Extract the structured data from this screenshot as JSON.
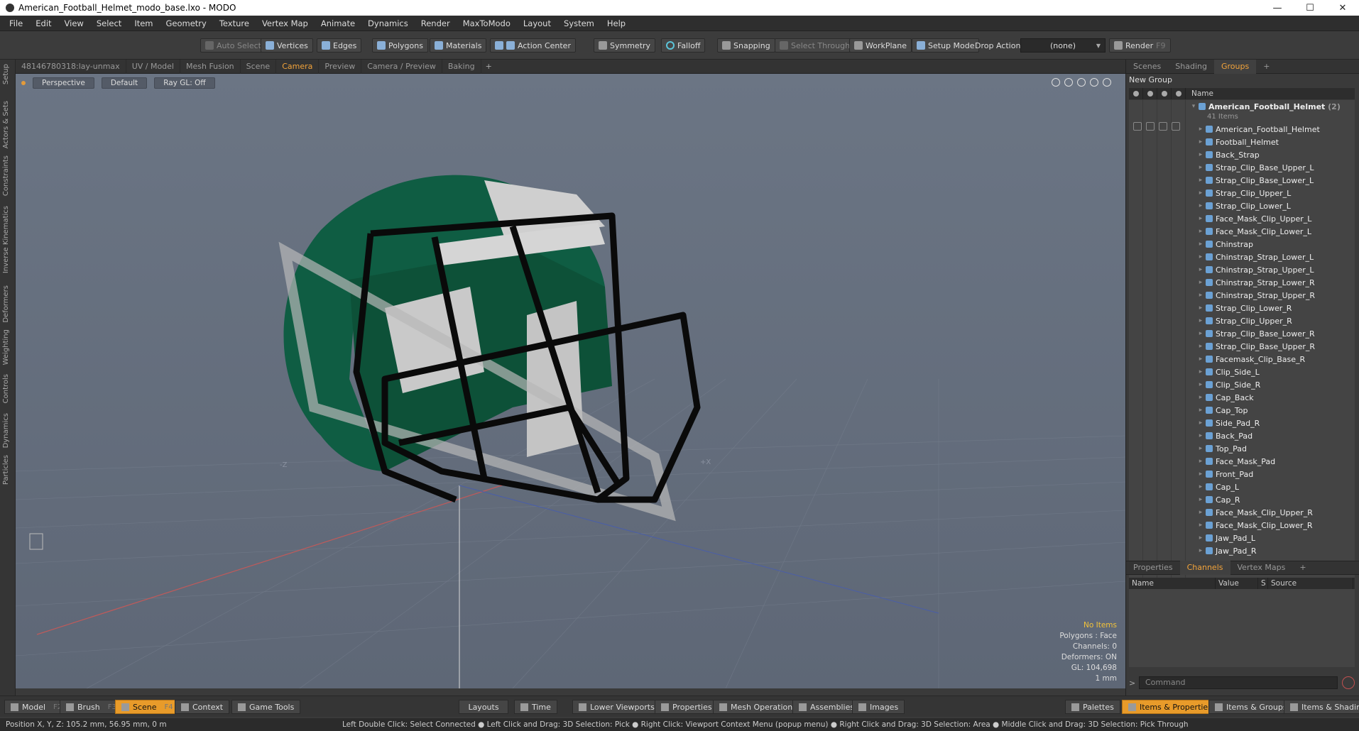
{
  "window": {
    "title": "American_Football_Helmet_modo_base.lxo - MODO",
    "min": "—",
    "max": "☐",
    "close": "✕"
  },
  "menu": [
    "File",
    "Edit",
    "View",
    "Select",
    "Item",
    "Geometry",
    "Texture",
    "Vertex Map",
    "Animate",
    "Dynamics",
    "Render",
    "MaxToModo",
    "Layout",
    "System",
    "Help"
  ],
  "toolbar": {
    "auto_select": "Auto Select",
    "vertices": "Vertices",
    "edges": "Edges",
    "polygons": "Polygons",
    "materials": "Materials",
    "action_center": "Action Center",
    "symmetry": "Symmetry",
    "falloff": "Falloff",
    "snapping": "Snapping",
    "select_through": "Select Through",
    "workplane": "WorkPlane",
    "setup_mode": "Setup Mode",
    "drop_action_label": "Drop Action",
    "drop_action_value": "(none)",
    "render": "Render",
    "render_key": "F9"
  },
  "left_tabs": [
    "Setup",
    "Actors & Sets",
    "Constraints",
    "Inverse Kinematics",
    "Deformers",
    "Weighting",
    "Controls",
    "Dynamics",
    "Particles"
  ],
  "viewport_tabs": [
    "48146780318:lay-unmax",
    "UV / Model",
    "Mesh Fusion",
    "Scene",
    "Camera",
    "Preview",
    "Camera / Preview",
    "Baking"
  ],
  "viewport_tab_plus": "+",
  "viewport": {
    "perspective": "Perspective",
    "shading": "Default",
    "raygl": "Ray GL: Off",
    "axis_neg_z": "-Z",
    "axis_pos_x": "+X",
    "info": {
      "items": "No Items",
      "polygons": "Polygons : Face",
      "channels": "Channels: 0",
      "deformers": "Deformers: ON",
      "gl": "GL: 104,698",
      "scale": "1 mm"
    }
  },
  "right_tabs": [
    "Scenes",
    "Shading",
    "Groups"
  ],
  "right_tab_plus": "+",
  "groups": {
    "new_group": "New Group",
    "name_header": "Name",
    "root": "American_Football_Helmet",
    "root_count": "(2)",
    "root_items": "41 Items",
    "items": [
      "American_Football_Helmet",
      "Football_Helmet",
      "Back_Strap",
      "Strap_Clip_Base_Upper_L",
      "Strap_Clip_Base_Lower_L",
      "Strap_Clip_Upper_L",
      "Strap_Clip_Lower_L",
      "Face_Mask_Clip_Upper_L",
      "Face_Mask_Clip_Lower_L",
      "Chinstrap",
      "Chinstrap_Strap_Lower_L",
      "Chinstrap_Strap_Upper_L",
      "Chinstrap_Strap_Lower_R",
      "Chinstrap_Strap_Upper_R",
      "Strap_Clip_Lower_R",
      "Strap_Clip_Upper_R",
      "Strap_Clip_Base_Lower_R",
      "Strap_Clip_Base_Upper_R",
      "Facemask_Clip_Base_R",
      "Clip_Side_L",
      "Clip_Side_R",
      "Cap_Back",
      "Cap_Top",
      "Side_Pad_R",
      "Back_Pad",
      "Top_Pad",
      "Face_Mask_Pad",
      "Front_Pad",
      "Cap_L",
      "Cap_R",
      "Face_Mask_Clip_Upper_R",
      "Face_Mask_Clip_Lower_R",
      "Jaw_Pad_L",
      "Jaw_Pad_R"
    ]
  },
  "props_tabs": [
    "Properties",
    "Channels",
    "Vertex Maps"
  ],
  "props_tab_plus": "+",
  "props_cols": [
    "Name",
    "Value",
    "S",
    "Source"
  ],
  "command_placeholder": "Command",
  "bottom": {
    "model": "Model",
    "model_key": "F2",
    "brush": "Brush",
    "brush_key": "F3",
    "scene": "Scene",
    "scene_key": "F4",
    "context": "Context",
    "game_tools": "Game Tools",
    "layouts": "Layouts",
    "time": "Time",
    "lower_viewports": "Lower Viewports",
    "properties": "Properties",
    "mesh_operations": "Mesh Operations",
    "assemblies": "Assemblies",
    "images": "Images",
    "palettes": "Palettes",
    "items_properties": "Items & Properties",
    "items_groups": "Items & Groups",
    "items_shading": "Items & Shading"
  },
  "status": {
    "position": "Position X, Y, Z:   105.2 mm, 56.95 mm, 0 m",
    "hint": "Left Double Click: Select Connected ● Left Click and Drag: 3D Selection: Pick ● Right Click: Viewport Context Menu (popup menu) ● Right Click and Drag: 3D Selection: Area ● Middle Click and Drag: 3D Selection: Pick Through"
  },
  "colors": {
    "accent": "#f2a33a",
    "helmet": "#0f5d43",
    "facemask": "#0a0a0a",
    "pads": "#c9c9c9"
  }
}
